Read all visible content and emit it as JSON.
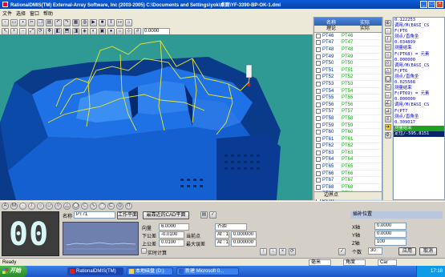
{
  "window": {
    "title": "RationalDMIS(TM) External-Array Software, Inc (2003-2005)     C:\\Documents and Settings\\yok\\桌面\\YF-3390-BP-OK-1.dmi"
  },
  "menu": [
    "文件",
    "选择",
    "窗口",
    "帮助"
  ],
  "toolbar": {
    "step_value": "0.0000"
  },
  "points": {
    "header_left": "名称",
    "header_right": "实际",
    "col_name": "理论",
    "col_actual": "实际",
    "rows": [
      {
        "name": "PT46",
        "actual": "PT46"
      },
      {
        "name": "PT47",
        "actual": "PT47"
      },
      {
        "name": "PT48",
        "actual": "PT48"
      },
      {
        "name": "PT49",
        "actual": "PT49"
      },
      {
        "name": "PT50",
        "actual": "PT50"
      },
      {
        "name": "PT51",
        "actual": "PT51"
      },
      {
        "name": "PT52",
        "actual": "PT52"
      },
      {
        "name": "PT53",
        "actual": "PT53"
      },
      {
        "name": "PT54",
        "actual": "PT54"
      },
      {
        "name": "PT55",
        "actual": "PT55"
      },
      {
        "name": "PT56",
        "actual": "PT56"
      },
      {
        "name": "PT57",
        "actual": "PT57"
      },
      {
        "name": "PT58",
        "actual": "PT58"
      },
      {
        "name": "PT59",
        "actual": "PT59"
      },
      {
        "name": "PT60",
        "actual": "PT60"
      },
      {
        "name": "PT61",
        "actual": "PT61"
      },
      {
        "name": "PT62",
        "actual": "PT62"
      },
      {
        "name": "PT63",
        "actual": "PT63"
      },
      {
        "name": "PT64",
        "actual": "PT64"
      },
      {
        "name": "PT65",
        "actual": "PT65"
      },
      {
        "name": "PT66",
        "actual": "PT66"
      },
      {
        "name": "PT67",
        "actual": "PT67"
      },
      {
        "name": "PT68",
        "actual": "PT68"
      },
      {
        "name": "PT69",
        "actual": "PT69"
      },
      {
        "name": "PT70",
        "actual": ""
      }
    ],
    "footer": "边界点"
  },
  "report": {
    "lines": [
      {
        "text": "0.122253",
        "style": "blue"
      },
      {
        "text": "调用/M(EASI_CS",
        "style": "blue"
      },
      {
        "text": "F(PT6",
        "style": "blue"
      },
      {
        "text": "测点/直角坐",
        "style": "blue"
      },
      {
        "text": "0.034899",
        "style": "blue"
      },
      {
        "text": "测量结束",
        "style": "blue"
      },
      {
        "text": "F(PT68) = 元素",
        "style": "blue"
      },
      {
        "text": "0.000000",
        "style": "blue"
      },
      {
        "text": "调用/M(EASI_CS",
        "style": "blue"
      },
      {
        "text": "F(PT6",
        "style": "blue"
      },
      {
        "text": "测点/直角坐",
        "style": "blue"
      },
      {
        "text": "0.025568",
        "style": "blue"
      },
      {
        "text": "测量结束",
        "style": "blue"
      },
      {
        "text": "F(PT69) = 元素",
        "style": "blue"
      },
      {
        "text": "0.000000",
        "style": "blue"
      },
      {
        "text": "调用/M(EASI_CS",
        "style": "blue"
      },
      {
        "text": "F(PT7",
        "style": "blue"
      },
      {
        "text": "测点/直角坐",
        "style": "blue"
      },
      {
        "text": "0.309017",
        "style": "blue"
      },
      {
        "text": "测量结束",
        "style": "hl"
      },
      {
        "text": "定位/-595.8151",
        "style": "sel"
      }
    ]
  },
  "counter": {
    "value": "00"
  },
  "props": {
    "name_label": "名称",
    "name_value": "PT71",
    "workplane_btn": "工作平面",
    "nearest_btn": "最靠近的CAD平面",
    "vector_label": "向量",
    "vector_value": "6.0000",
    "approach_label": "下公差",
    "approach_value": "-0.0100",
    "upper_label": "上公差",
    "upper_value": "0.0100",
    "cur_label": "当前点",
    "cur_value": "At : 1",
    "target_label": "最大误差",
    "target_value": "At : 1",
    "realtime_label": "实时计算",
    "mode_value": "齐距",
    "val_a": "0.000000",
    "val_b": "0.000000"
  },
  "modepanel": {
    "title": "插补位置",
    "x_label": "X轴",
    "x_value": "0.0000",
    "y_label": "Y轴",
    "y_value": "0.0000",
    "z_label": "Z轴",
    "z_value": "100",
    "count_label": "个数",
    "count_value": "30",
    "apply_btn": "应用",
    "cancel_btn": "取消"
  },
  "statusbar": {
    "ready": "Ready",
    "unit": "毫米",
    "angle": "角度",
    "coord": "Car"
  },
  "taskbar": {
    "start": "开始",
    "tasks": [
      "RationalDMIS(TM)",
      "本地磁盘 (D:)",
      "新建 Microsoft 0..."
    ],
    "clock": "17:18"
  }
}
